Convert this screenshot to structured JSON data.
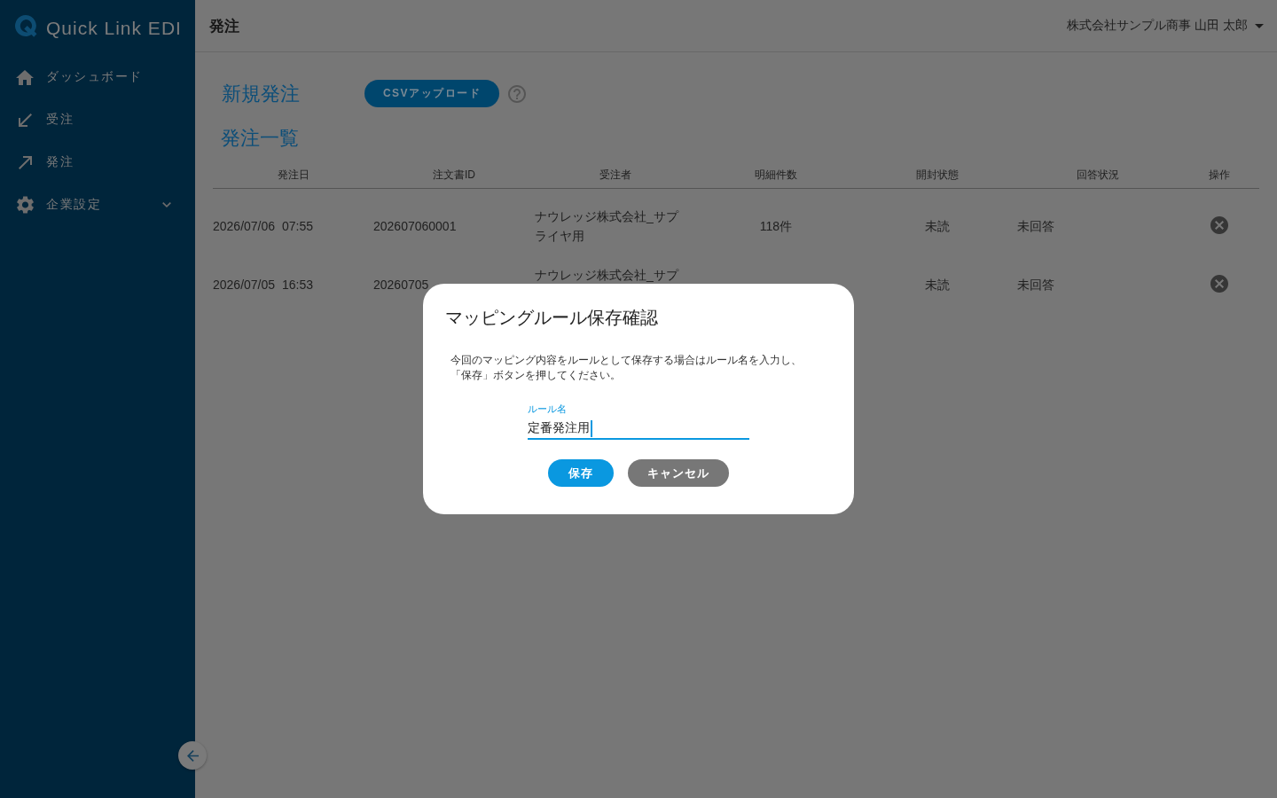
{
  "sidebar": {
    "app_name": "Quick Link EDI",
    "items": [
      {
        "label": "ダッシュボード",
        "kind": "link"
      },
      {
        "label": "受注",
        "kind": "link"
      },
      {
        "label": "発注",
        "kind": "link"
      },
      {
        "label": "企業設定",
        "kind": "group",
        "expanded": false
      }
    ]
  },
  "header": {
    "title": "発注",
    "user": "株式会社サンプル商事 山田 太郎"
  },
  "new_order": {
    "title": "新規発注",
    "upload_button": "CSVアップロード"
  },
  "order_list": {
    "title": "発注一覧",
    "columns": [
      "発注日",
      "注文書ID",
      "受注者",
      "明細件数",
      "開封状態",
      "回答状況",
      "操作"
    ],
    "rows": [
      {
        "order_date": "2026/07/06 07:55",
        "order_id": "202607060001",
        "recipient": "ナウレッジ株式会社_サプライヤ用",
        "line_count": "118件",
        "open_status": "未読",
        "reply_status": "未回答"
      },
      {
        "order_date": "2026/07/05 16:53",
        "order_id": "20260705",
        "recipient": "ナウレッジ株式会社_サプ",
        "open_status": "未読",
        "reply_status": "未回答"
      }
    ]
  },
  "dialog": {
    "title": "マッピングルール保存確認",
    "message": "今回のマッピング内容をルールとして保存する場合はルール名を入力し、「保存」ボタンを押してください。",
    "field": {
      "label": "ルール名",
      "value": "定番発注用",
      "focused": true
    },
    "buttons": [
      {
        "label": "保存",
        "kind": "primary"
      },
      {
        "label": "キャンセル",
        "kind": "secondary"
      }
    ]
  }
}
